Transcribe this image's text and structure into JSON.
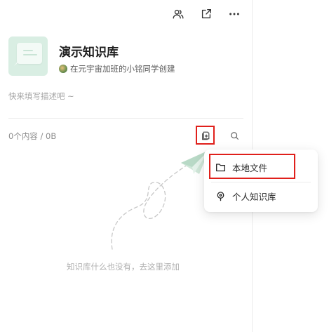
{
  "toolbar": {
    "members_icon": "members-icon",
    "share_icon": "share-icon",
    "more_icon": "more-icon"
  },
  "kb": {
    "title": "演示知识库",
    "creator": "在元宇宙加班的小铭同学创建",
    "description_placeholder": "快来填写描述吧 ~"
  },
  "content": {
    "count": "0个内容 / 0B",
    "empty_text": "知识库什么也没有，去这里添加"
  },
  "menu": {
    "items": [
      {
        "label": "本地文件",
        "icon": "folder-icon"
      },
      {
        "label": "个人知识库",
        "icon": "bulb-icon"
      }
    ]
  },
  "colors": {
    "highlight": "#e0201b",
    "cover_bg": "#d9eee3",
    "plane": "#cfe6d8"
  }
}
